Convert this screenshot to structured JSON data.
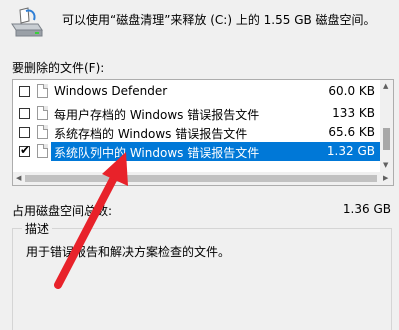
{
  "header": {
    "drive_icon": "drive-cleanup-icon",
    "text": "可以使用“磁盘清理”来释放 (C:) 上的 1.55 GB 磁盘空间。"
  },
  "files": {
    "label": "要删除的文件(F):",
    "items": [
      {
        "name": "Windows Defender",
        "size": "60.0 KB",
        "checked": false,
        "selected": false
      },
      {
        "name": "每用户存档的 Windows 错误报告文件",
        "size": "133 KB",
        "checked": false,
        "selected": false
      },
      {
        "name": "系统存档的 Windows 错误报告文件",
        "size": "65.6 KB",
        "checked": false,
        "selected": false
      },
      {
        "name": "系统队列中的 Windows 错误报告文件",
        "size": "1.32 GB",
        "checked": true,
        "selected": true
      }
    ]
  },
  "total": {
    "label": "占用磁盘空间总数:",
    "value": "1.36 GB"
  },
  "description": {
    "title": "描述",
    "text": "用于错误报告和解决方案检查的文件。"
  },
  "colors": {
    "selection": "#0078d7",
    "annotation_arrow": "#e8222a"
  }
}
